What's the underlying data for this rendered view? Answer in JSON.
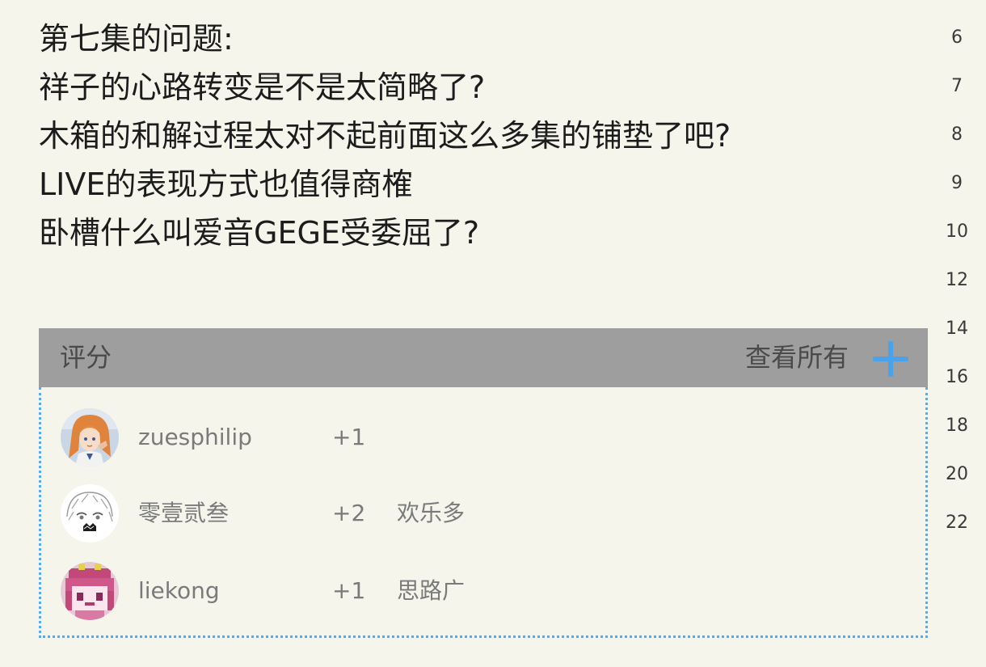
{
  "post": {
    "lines": [
      "第七集的问题:",
      "祥子的心路转变是不是太简略了?",
      "木箱的和解过程太对不起前面这么多集的铺垫了吧?",
      "LIVE的表现方式也值得商榷",
      "卧槽什么叫爱音GEGE受委屈了?"
    ]
  },
  "gutter": {
    "numbers": [
      "6",
      "7",
      "8",
      "9",
      "10",
      "12",
      "14",
      "16",
      "18",
      "20",
      "22"
    ]
  },
  "rating": {
    "title": "评分",
    "view_all_label": "查看所有",
    "plus_icon": "plus-icon",
    "accent_color": "#4aa3ea",
    "rows": [
      {
        "username": "zuesphilip",
        "score": "+1",
        "reason": "",
        "avatar": "anime-girl-orange-hair-avatar"
      },
      {
        "username": "零壹贰叁",
        "score": "+2",
        "reason": "欢乐多",
        "avatar": "anime-sketch-face-avatar"
      },
      {
        "username": "liekong",
        "score": "+1",
        "reason": "思路广",
        "avatar": "pink-pixel-character-avatar"
      }
    ]
  }
}
